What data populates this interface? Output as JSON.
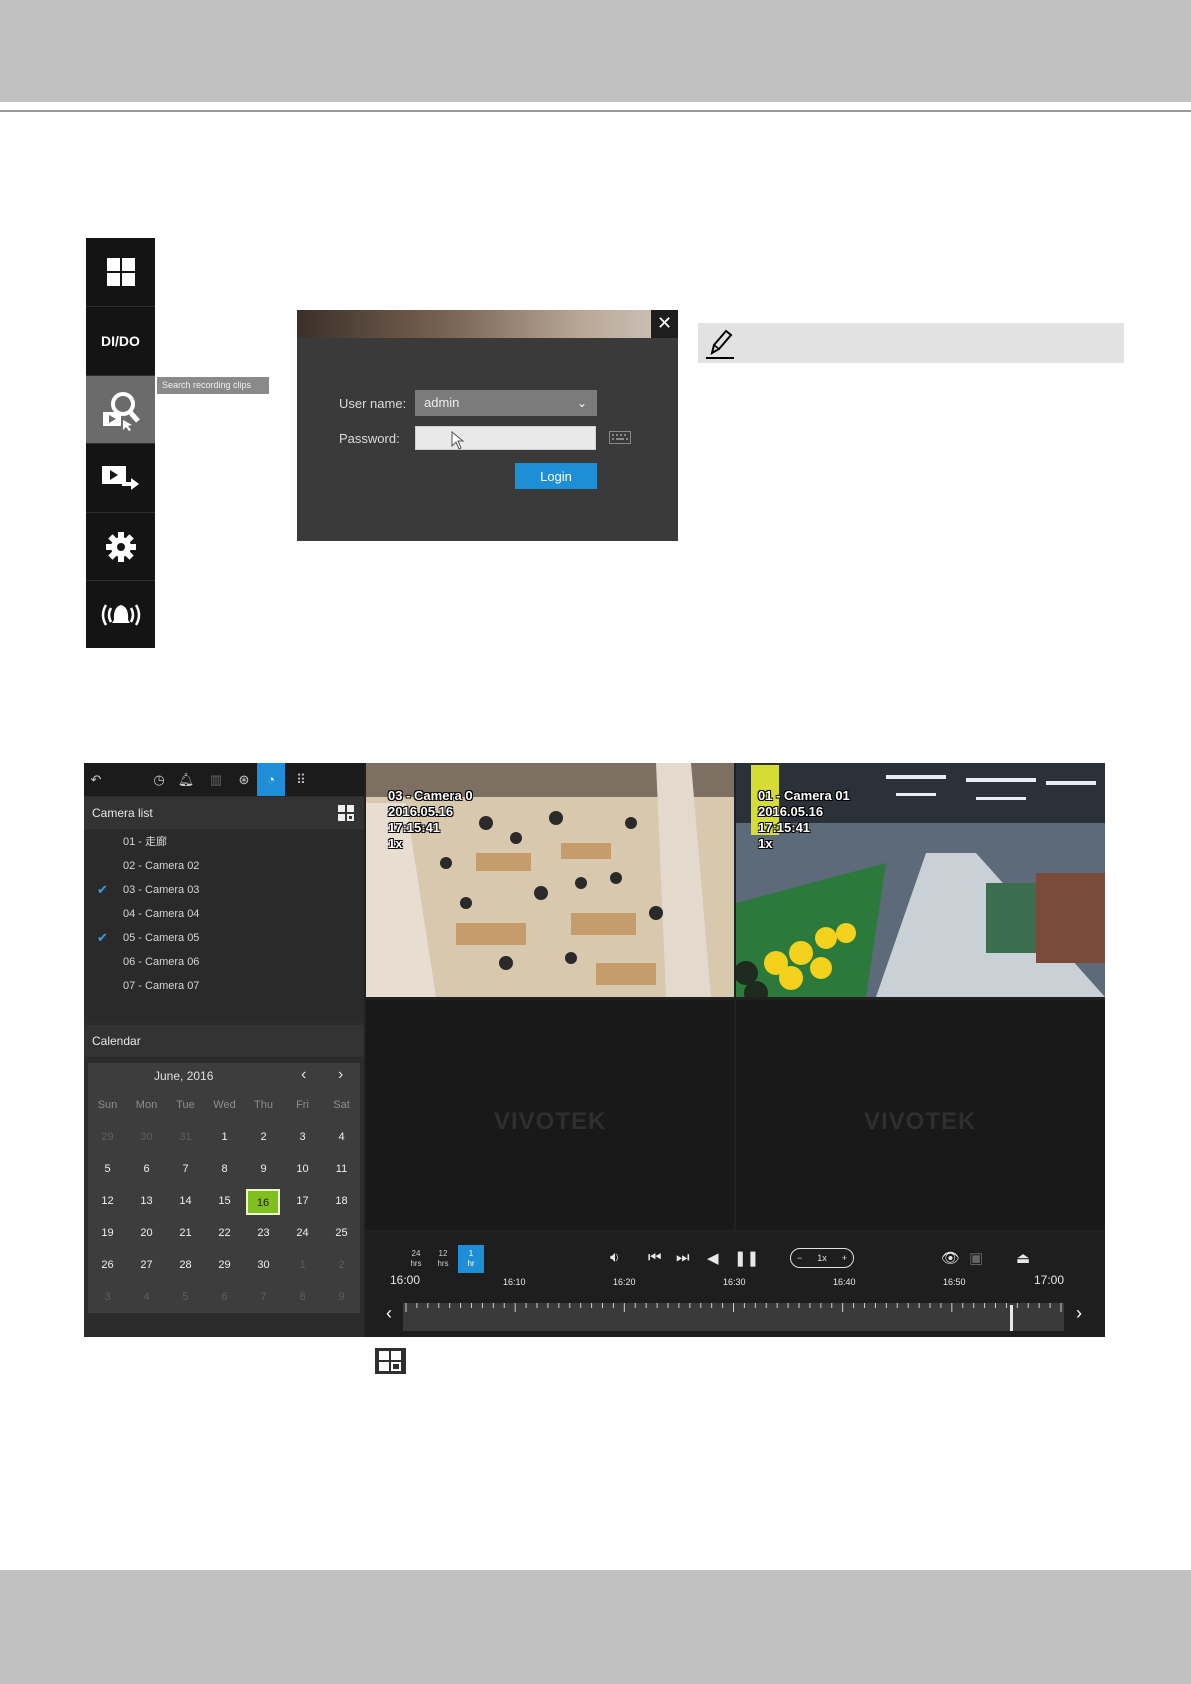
{
  "login": {
    "user_label": "User name:",
    "user_value": "admin",
    "password_label": "Password:",
    "login_button": "Login",
    "close_glyph": "✕"
  },
  "toolbar": {
    "items": [
      {
        "name": "layout",
        "icon": "grid-icon"
      },
      {
        "name": "dido",
        "label": "DI/DO"
      },
      {
        "name": "search",
        "icon": "search-recording-icon",
        "active": true
      },
      {
        "name": "export",
        "icon": "export-icon"
      },
      {
        "name": "settings",
        "icon": "gear-icon"
      },
      {
        "name": "alarm",
        "icon": "alarm-bell-icon"
      }
    ],
    "tooltip": "Search recording clips"
  },
  "playback": {
    "camera_list_title": "Camera list",
    "cameras": [
      {
        "label": "01 - 走廊",
        "checked": false
      },
      {
        "label": "02 - Camera 02",
        "checked": false
      },
      {
        "label": "03 - Camera 03",
        "checked": true
      },
      {
        "label": "04 - Camera 04",
        "checked": false
      },
      {
        "label": "05 - Camera 05",
        "checked": true
      },
      {
        "label": "06 - Camera 06",
        "checked": false
      },
      {
        "label": "07 - Camera 07",
        "checked": false
      }
    ],
    "calendar_title": "Calendar",
    "calendar": {
      "month": "June, 2016",
      "weekdays": [
        "Sun",
        "Mon",
        "Tue",
        "Wed",
        "Thu",
        "Fri",
        "Sat"
      ],
      "weeks": [
        [
          "29",
          "30",
          "31",
          "1",
          "2",
          "3",
          "4"
        ],
        [
          "5",
          "6",
          "7",
          "8",
          "9",
          "10",
          "11"
        ],
        [
          "12",
          "13",
          "14",
          "15",
          "16",
          "17",
          "18"
        ],
        [
          "19",
          "20",
          "21",
          "22",
          "23",
          "24",
          "25"
        ],
        [
          "26",
          "27",
          "28",
          "29",
          "30",
          "1",
          "2"
        ],
        [
          "3",
          "4",
          "5",
          "6",
          "7",
          "8",
          "9"
        ]
      ],
      "selected": "16"
    },
    "tiles": [
      {
        "osd": [
          "03 - Camera 0",
          "2016.05.16",
          "17:15:41",
          "1x"
        ]
      },
      {
        "osd": [
          "01 - Camera 01",
          "2016.05.16",
          "17:15:41",
          "1x"
        ]
      },
      {
        "logo": "VIVOTEK"
      },
      {
        "logo": "VIVOTEK"
      }
    ],
    "ranges": [
      {
        "top": "24",
        "bottom": "hrs"
      },
      {
        "top": "12",
        "bottom": "hrs"
      },
      {
        "top": "1",
        "bottom": "hr",
        "active": true
      }
    ],
    "speed": "1x",
    "timeline": {
      "start": "16:00",
      "end": "17:00",
      "ticks": [
        "16:10",
        "16:20",
        "16:30",
        "16:40",
        "16:50"
      ],
      "cursor_time_fraction": 0.92
    }
  }
}
